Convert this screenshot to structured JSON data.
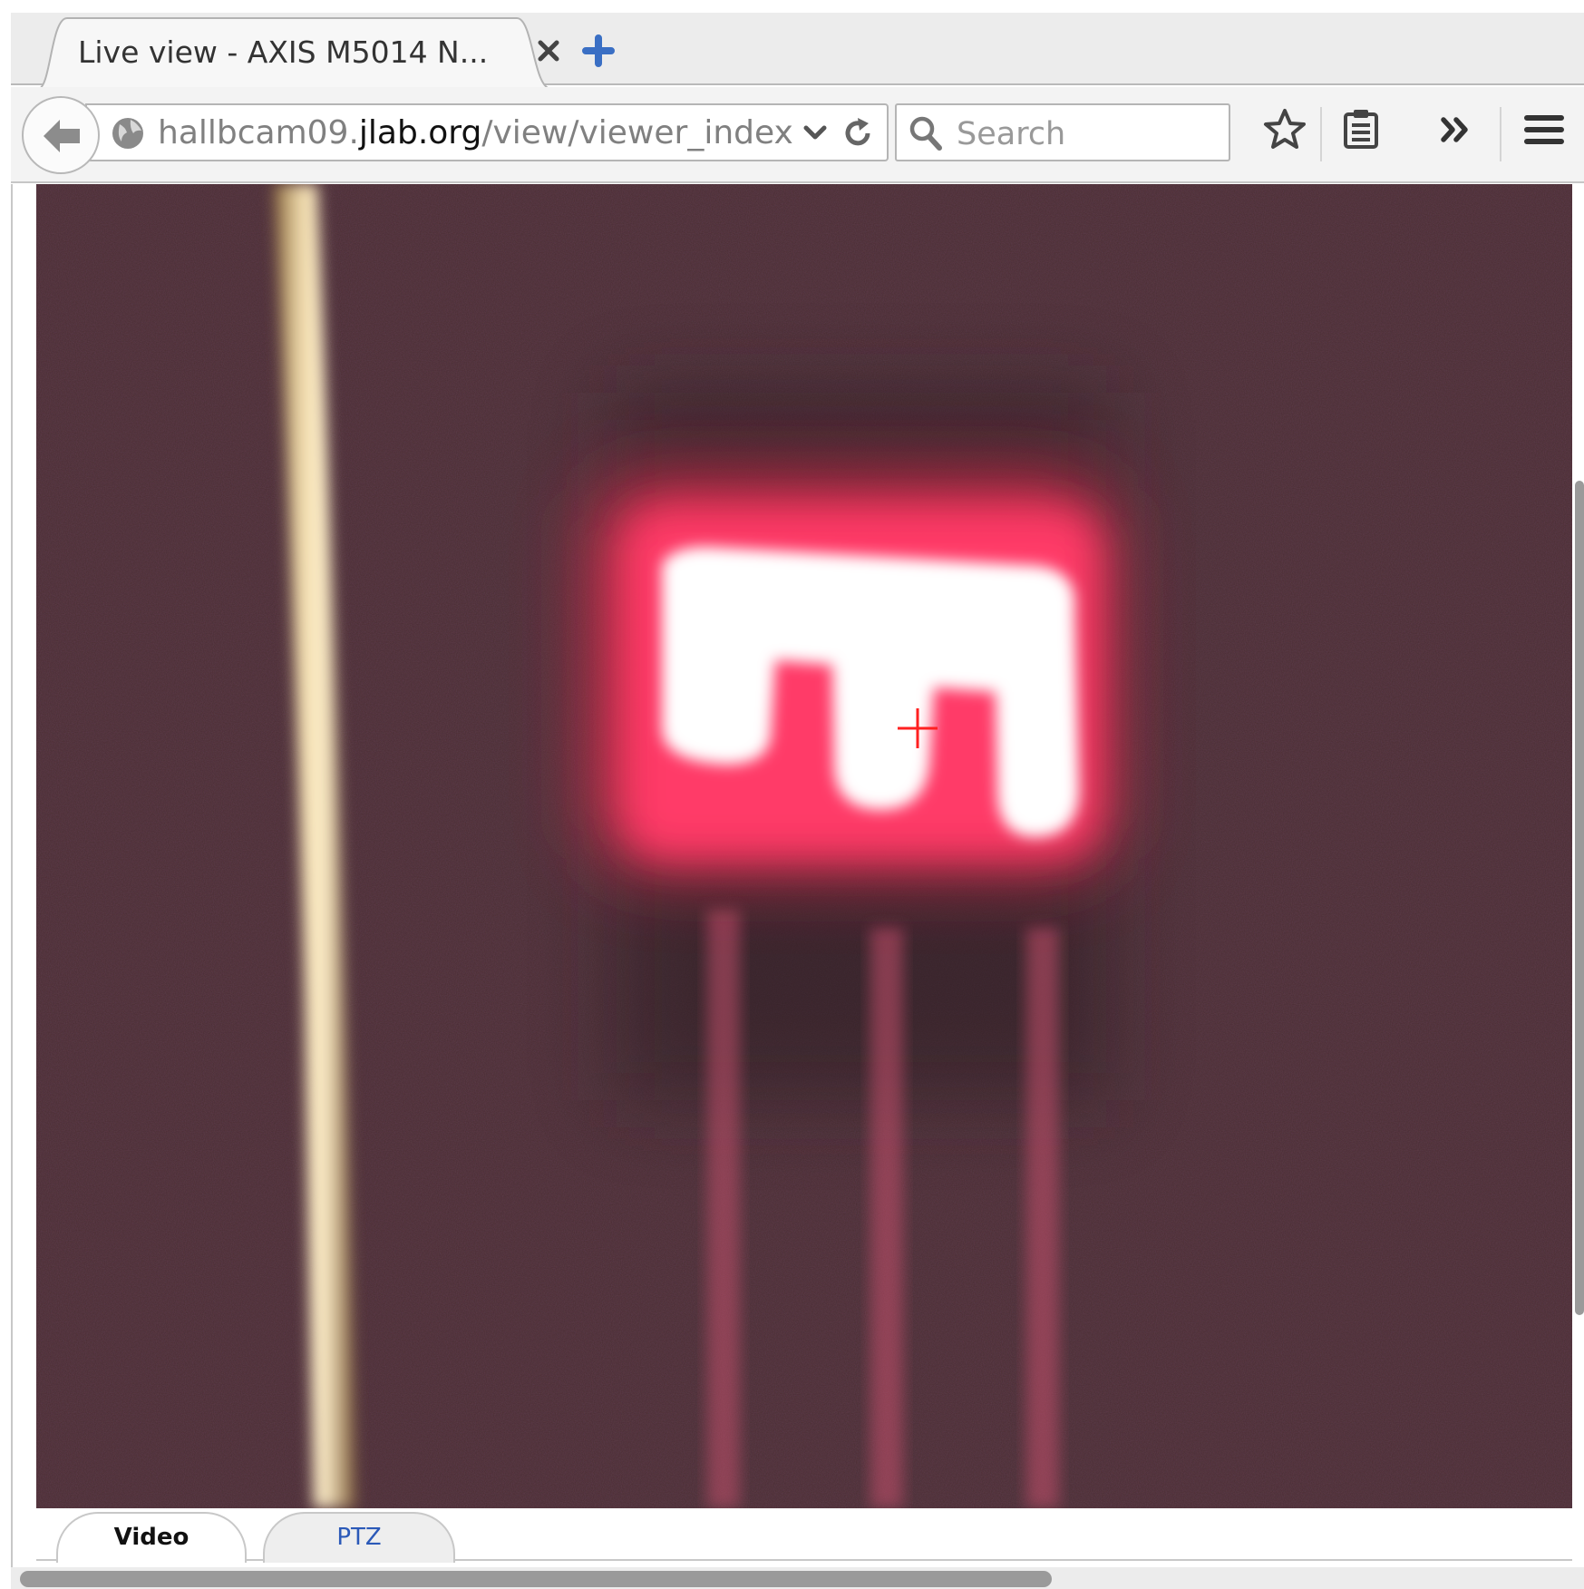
{
  "browser": {
    "tab_title": "Live view - AXIS M5014 N...",
    "url": {
      "prefix": "hallbcam09.",
      "host": "jlab.org",
      "path": "/view/viewer_index.sh"
    },
    "search_placeholder": "Search",
    "icons": {
      "back": "back-arrow-icon",
      "site": "globe-icon",
      "dropdown": "chevron-down-icon",
      "reload": "reload-icon",
      "search": "search-icon",
      "bookmark": "star-icon",
      "reading_list": "clipboard-icon",
      "overflow": "double-chevron-icon",
      "menu": "hamburger-menu-icon",
      "close_tab": "close-icon",
      "new_tab": "plus-icon"
    }
  },
  "viewer": {
    "tabs": [
      {
        "label": "Video",
        "active": true
      },
      {
        "label": "PTZ",
        "active": false
      }
    ],
    "crosshair_color": "#ff2020"
  },
  "colors": {
    "link_blue": "#2b59b8",
    "new_tab_blue": "#3a6fc4",
    "glow_red": "#ff2d55"
  }
}
